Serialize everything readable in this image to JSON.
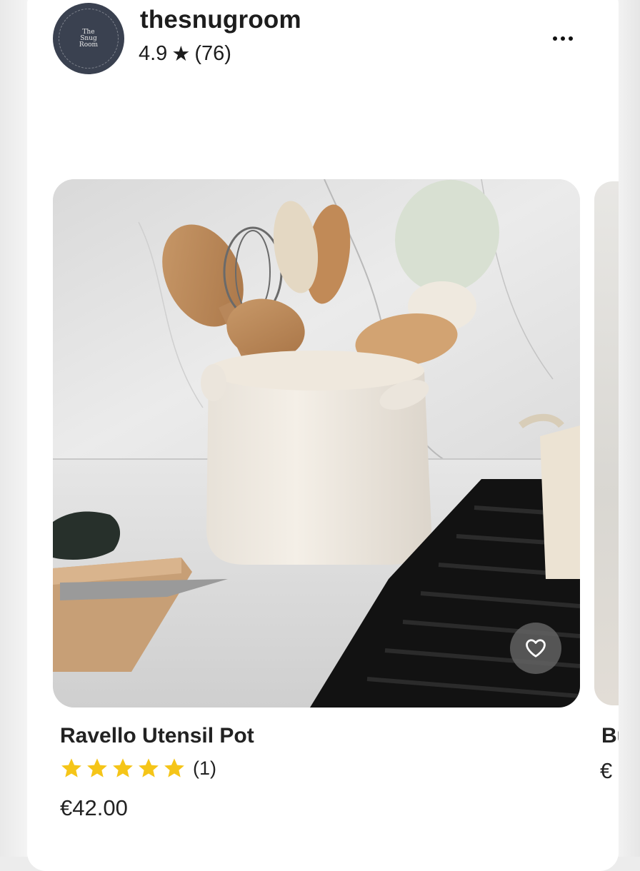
{
  "shop": {
    "name": "thesnugroom",
    "rating": "4.9",
    "rating_star": "★",
    "review_count": "(76)",
    "logo_lines": [
      "The",
      "Snug",
      "Room"
    ]
  },
  "header": {
    "more_icon": "more-horizontal-icon"
  },
  "listing": {
    "title": "Ravello Utensil Pot",
    "stars": 5,
    "star_color": "#f5c518",
    "review_count": "(1)",
    "price": "€42.00",
    "favorite_icon": "heart-outline-icon"
  },
  "next_listing": {
    "title_partial": "Bu",
    "price_partial": "€"
  },
  "colors": {
    "avatar_bg": "#3a4150",
    "card_bg": "#ffffff",
    "fav_button_bg": "#626262"
  }
}
